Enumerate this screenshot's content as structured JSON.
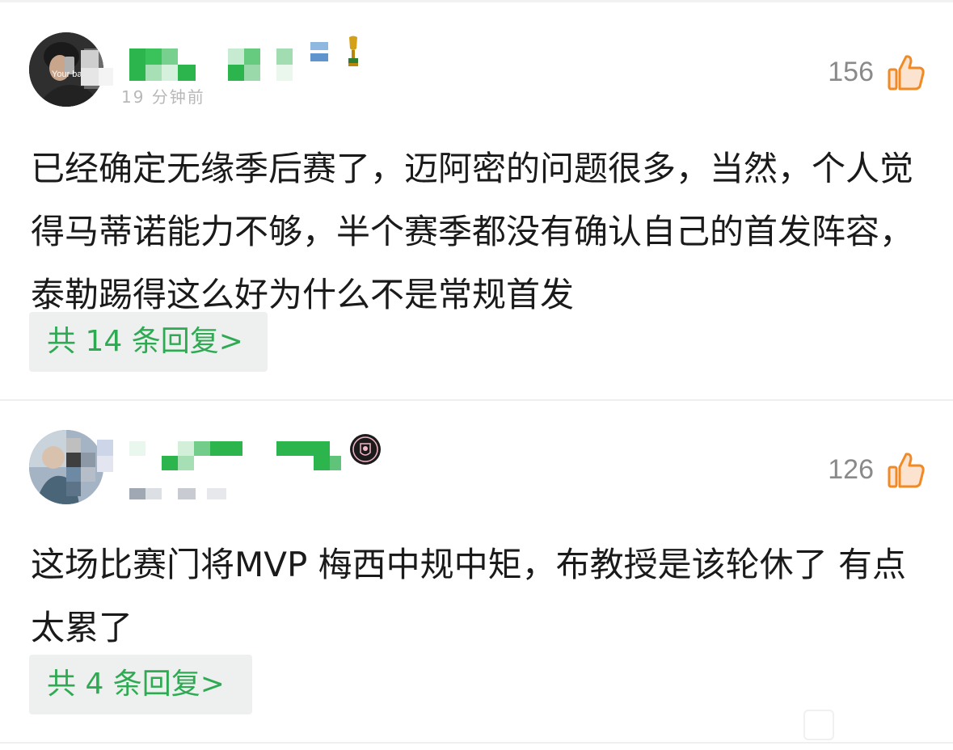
{
  "comments": [
    {
      "time": "19 分钟前",
      "likes": "156",
      "text": "已经确定无缘季后赛了，迈阿密的问题很多，当然，个人觉得马蒂诺能力不够，半个赛季都没有确认自己的首发阵容，泰勒踢得这么好为什么不是常规首发",
      "reply_label": "共 14 条回复>",
      "avatar_caption": "Your bag."
    },
    {
      "time": "",
      "likes": "126",
      "text": "这场比赛门将MVP 梅西中规中矩，布教授是该轮休了 有点太累了",
      "reply_label": "共 4 条回复>"
    }
  ],
  "icons": {
    "like": "thumbs-up-icon",
    "badge1": "trophy-icon",
    "badge2": "club-crest-icon"
  },
  "colors": {
    "accent_green": "#2eaa52",
    "like_orange": "#f08a24",
    "text": "#1a1a1a",
    "muted": "#8a8a8a"
  }
}
